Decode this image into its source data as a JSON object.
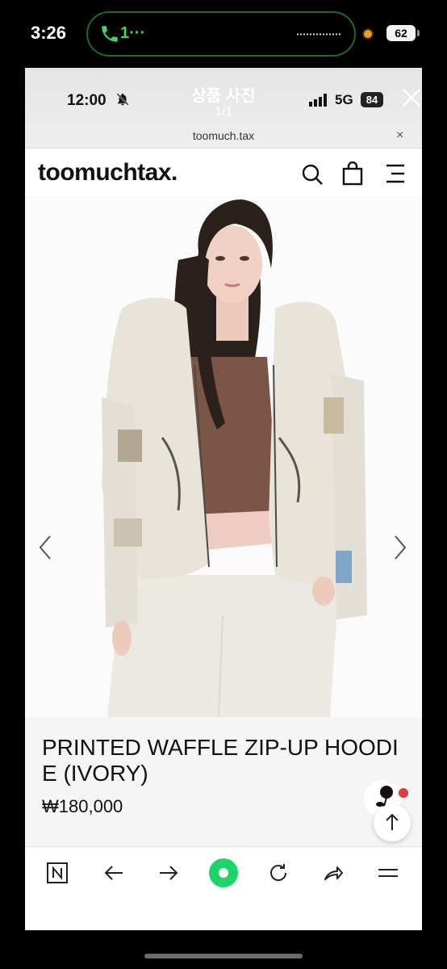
{
  "outer_status": {
    "time": "3:26",
    "call_text": "1···",
    "battery": "62"
  },
  "inner_status": {
    "time": "12:00",
    "network": "5G",
    "battery": "84"
  },
  "gallery": {
    "title": "상품 사진",
    "count": "1/1"
  },
  "browser": {
    "url": "toomuch.tax",
    "url_close": "×"
  },
  "site": {
    "logo": "toomuchtax."
  },
  "product": {
    "name": "PRINTED WAFFLE ZIP-UP HOODIE (IVORY)",
    "price": "₩180,000"
  },
  "icons": [
    "search-icon",
    "bag-icon",
    "menu-icon",
    "arrow-left-icon",
    "arrow-right-icon",
    "close-icon",
    "naver-icon",
    "back-icon",
    "forward-icon",
    "home-icon",
    "refresh-icon",
    "share-icon",
    "menu-lines-icon"
  ],
  "colors": {
    "call_green": "#3fd36b",
    "accent_green": "#1fd36b",
    "badge_red": "#e53a3a"
  }
}
